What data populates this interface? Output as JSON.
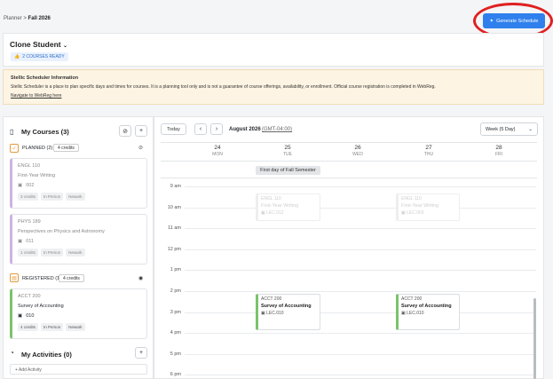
{
  "breadcrumb": {
    "root": "Planner",
    "sep": ">",
    "current": "Fall 2026"
  },
  "header": {
    "generate_label": "Generate Schedule"
  },
  "student": {
    "name": "Clone Student",
    "courses_ready": "2 COURSES READY"
  },
  "info": {
    "title": "Stellic Scheduler Information",
    "text": "Stellic Scheduler is a place to plan specific days and times for courses. It is a planning tool only and is not a guarantee of course offerings, availability, or enrollment. Official course registration is completed in WebReg.",
    "link": "Navigate to WebReg here"
  },
  "my_courses": {
    "title": "My Courses (3)",
    "planned_label": "PLANNED (2)",
    "planned_credits": "4 credits",
    "registered_label": "REGISTERED (1)",
    "registered_credits": "4 credits",
    "planned": [
      {
        "code": "ENGL 110",
        "title": "First-Year Writing",
        "section": "002",
        "tags": [
          "3 credits",
          "In Person",
          "Newark"
        ]
      },
      {
        "code": "PHYS 189",
        "title": "Perspectives on Physics and Astronomy",
        "section": "011",
        "tags": [
          "1 credits",
          "In Person",
          "Newark"
        ]
      }
    ],
    "registered": [
      {
        "code": "ACCT 200",
        "title": "Survey of Accounting",
        "section": "010",
        "tags": [
          "4 credits",
          "In Person",
          "Newark"
        ]
      }
    ]
  },
  "my_activities": {
    "title": "My Activities (0)",
    "add_label": "+ Add Activity"
  },
  "calendar": {
    "today": "Today",
    "month": "August 2026",
    "tz": "(GMT-04:00)",
    "view": "Week (5 Day)",
    "days": [
      {
        "num": "24",
        "dow": "MON"
      },
      {
        "num": "25",
        "dow": "TUE"
      },
      {
        "num": "26",
        "dow": "WED"
      },
      {
        "num": "27",
        "dow": "THU"
      },
      {
        "num": "28",
        "dow": "FRI"
      }
    ],
    "allday_event": "First day of Fall Semester",
    "times": [
      "9 am",
      "10 am",
      "11 am",
      "12 pm",
      "1 pm",
      "2 pm",
      "3 pm",
      "4 pm",
      "5 pm",
      "6 pm"
    ],
    "ghost_events": [
      {
        "code": "ENGL 110",
        "title": "First-Year Writing",
        "section": "LEC.012"
      },
      {
        "code": "ENGL 110",
        "title": "First-Year Writing",
        "section": "LEC.003"
      }
    ],
    "events": [
      {
        "code": "ACCT 200",
        "title": "Survey of Accounting",
        "section": "LEC.010"
      },
      {
        "code": "ACCT 200",
        "title": "Survey of Accounting",
        "section": "LEC.010"
      }
    ]
  },
  "colors": {
    "accent": "#2f80ed",
    "registered": "#7ac36a",
    "planned": "#cfb3e0",
    "highlight": "#e02020"
  }
}
